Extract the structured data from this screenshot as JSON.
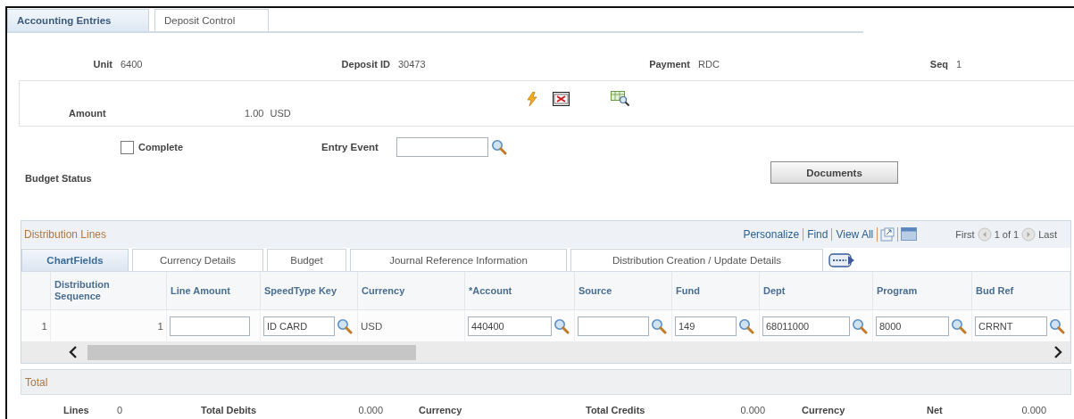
{
  "tabs": [
    {
      "label": "Accounting Entries",
      "selected": true
    },
    {
      "label": "Deposit Control",
      "selected": false
    }
  ],
  "header_fields": [
    {
      "label": "Unit",
      "value": "6400"
    },
    {
      "label": "Deposit ID",
      "value": "30473"
    },
    {
      "label": "Payment",
      "value": "RDC"
    },
    {
      "label": "Seq",
      "value": "1"
    }
  ],
  "amount": {
    "label": "Amount",
    "value": "1.00 USD"
  },
  "complete": {
    "label": "Complete",
    "checked": false
  },
  "entry_event": {
    "label": "Entry Event"
  },
  "budget_status": {
    "label": "Budget Status"
  },
  "documents_button": {
    "label": "Documents"
  },
  "distribution_lines": {
    "title": "Distribution Lines",
    "links": [
      "Personalize",
      "Find",
      "View All"
    ],
    "pager": {
      "first": "First",
      "position": "1 of 1",
      "last": "Last"
    },
    "tabs": [
      {
        "label": "ChartFields",
        "selected": true
      },
      {
        "label": "Currency Details",
        "selected": false
      },
      {
        "label": "Budget",
        "selected": false
      },
      {
        "label": "Journal Reference Information",
        "selected": false
      },
      {
        "label": "Distribution Creation / Update Details",
        "selected": false
      }
    ],
    "columns": [
      "Distribution Sequence",
      "Line Amount",
      "SpeedType Key",
      "Currency",
      "*Account",
      "Source",
      "Fund",
      "Dept",
      "Program",
      "Bud Ref"
    ],
    "rows": [
      {
        "number": "1",
        "cells": [
          {
            "kind": "text",
            "text": "1"
          },
          {
            "kind": "input"
          },
          {
            "kind": "lookup",
            "value": "ID CARD"
          },
          {
            "kind": "label",
            "text": "USD"
          },
          {
            "kind": "lookup",
            "value": "440400"
          },
          {
            "kind": "lookup"
          },
          {
            "kind": "lookup",
            "value": "149"
          },
          {
            "kind": "lookup",
            "value": "68011000"
          },
          {
            "kind": "lookup",
            "value": "8000"
          },
          {
            "kind": "lookup",
            "value": "CRRNT"
          }
        ]
      }
    ]
  },
  "total": {
    "title": "Total",
    "fields": [
      {
        "label": "Lines",
        "value": "0"
      },
      {
        "label": "Total Debits",
        "value": "0.000"
      },
      {
        "label": "Currency"
      },
      {
        "label": "Total Credits",
        "value": "0.000"
      },
      {
        "label": "Currency"
      },
      {
        "label": "Net",
        "value": "0.000"
      }
    ]
  }
}
